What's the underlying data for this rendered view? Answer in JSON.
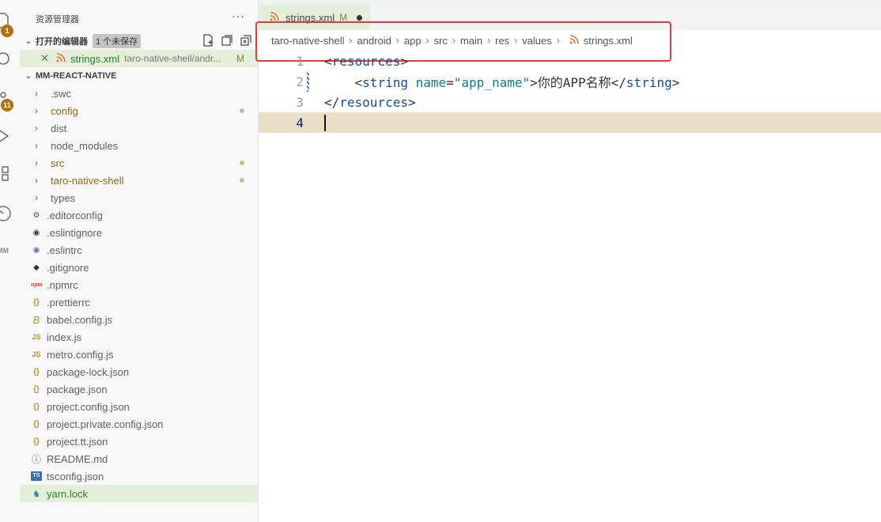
{
  "activity_bar": {
    "badges": [
      "1",
      "11"
    ],
    "items": [
      "explorer-icon",
      "search-icon",
      "source-control-icon",
      "run-debug-icon",
      "extensions-icon",
      "remote-icon"
    ],
    "extra_label": "MM"
  },
  "sidebar": {
    "title": "资源管理器",
    "more": "···",
    "open_editors": {
      "label": "打开的编辑器",
      "unsaved_badge": "1 个未保存",
      "items": [
        {
          "name": "strings.xml",
          "path": "taro-native-shell/andr...",
          "status": "M"
        }
      ]
    },
    "project": {
      "label": "MM-REACT-NATIVE",
      "folders": [
        {
          "name": ".swc",
          "modified": false
        },
        {
          "name": "config",
          "modified": true
        },
        {
          "name": "dist",
          "modified": false
        },
        {
          "name": "node_modules",
          "modified": false
        },
        {
          "name": "src",
          "modified": true
        },
        {
          "name": "taro-native-shell",
          "modified": true
        },
        {
          "name": "types",
          "modified": false
        }
      ],
      "files": [
        {
          "name": ".editorconfig",
          "icon": "gear-icon"
        },
        {
          "name": ".eslintignore",
          "icon": "eslint-icon"
        },
        {
          "name": ".eslintrc",
          "icon": "eslint-icon"
        },
        {
          "name": ".gitignore",
          "icon": "git-icon"
        },
        {
          "name": ".npmrc",
          "icon": "npm-icon"
        },
        {
          "name": ".prettierrc",
          "icon": "json-icon"
        },
        {
          "name": "babel.config.js",
          "icon": "babel-icon"
        },
        {
          "name": "index.js",
          "icon": "js-icon"
        },
        {
          "name": "metro.config.js",
          "icon": "js-icon"
        },
        {
          "name": "package-lock.json",
          "icon": "json-icon"
        },
        {
          "name": "package.json",
          "icon": "json-icon"
        },
        {
          "name": "project.config.json",
          "icon": "json-icon"
        },
        {
          "name": "project.private.config.json",
          "icon": "json-icon"
        },
        {
          "name": "project.tt.json",
          "icon": "json-icon"
        },
        {
          "name": "README.md",
          "icon": "info-icon"
        },
        {
          "name": "tsconfig.json",
          "icon": "ts-icon"
        },
        {
          "name": "yarn.lock",
          "icon": "yarn-icon"
        }
      ]
    }
  },
  "editor": {
    "tab": {
      "name": "strings.xml",
      "status": "M"
    },
    "breadcrumbs": [
      "taro-native-shell",
      "android",
      "app",
      "src",
      "main",
      "res",
      "values",
      "strings.xml"
    ],
    "line_numbers": [
      "1",
      "2",
      "3",
      "4"
    ],
    "code": {
      "l1_open": "<",
      "l1_tag": "resources",
      "l1_close": ">",
      "l2_indent": "    ",
      "l2_open": "<",
      "l2_tag": "string",
      "l2_attr": " name",
      "l2_eq": "=",
      "l2_val": "\"app_name\"",
      "l2_gt": ">",
      "l2_text": "你的APP名称",
      "l2_end_open": "</",
      "l2_end_tag": "string",
      "l2_end_close": ">",
      "l3_open": "</",
      "l3_tag": "resources",
      "l3_close": ">"
    }
  },
  "colors": {
    "highlight_box": "#e23b3b",
    "selection_bg": "#e4efda",
    "current_line_bg": "#e9dfc8",
    "modified_text": "#8f6b0f"
  }
}
